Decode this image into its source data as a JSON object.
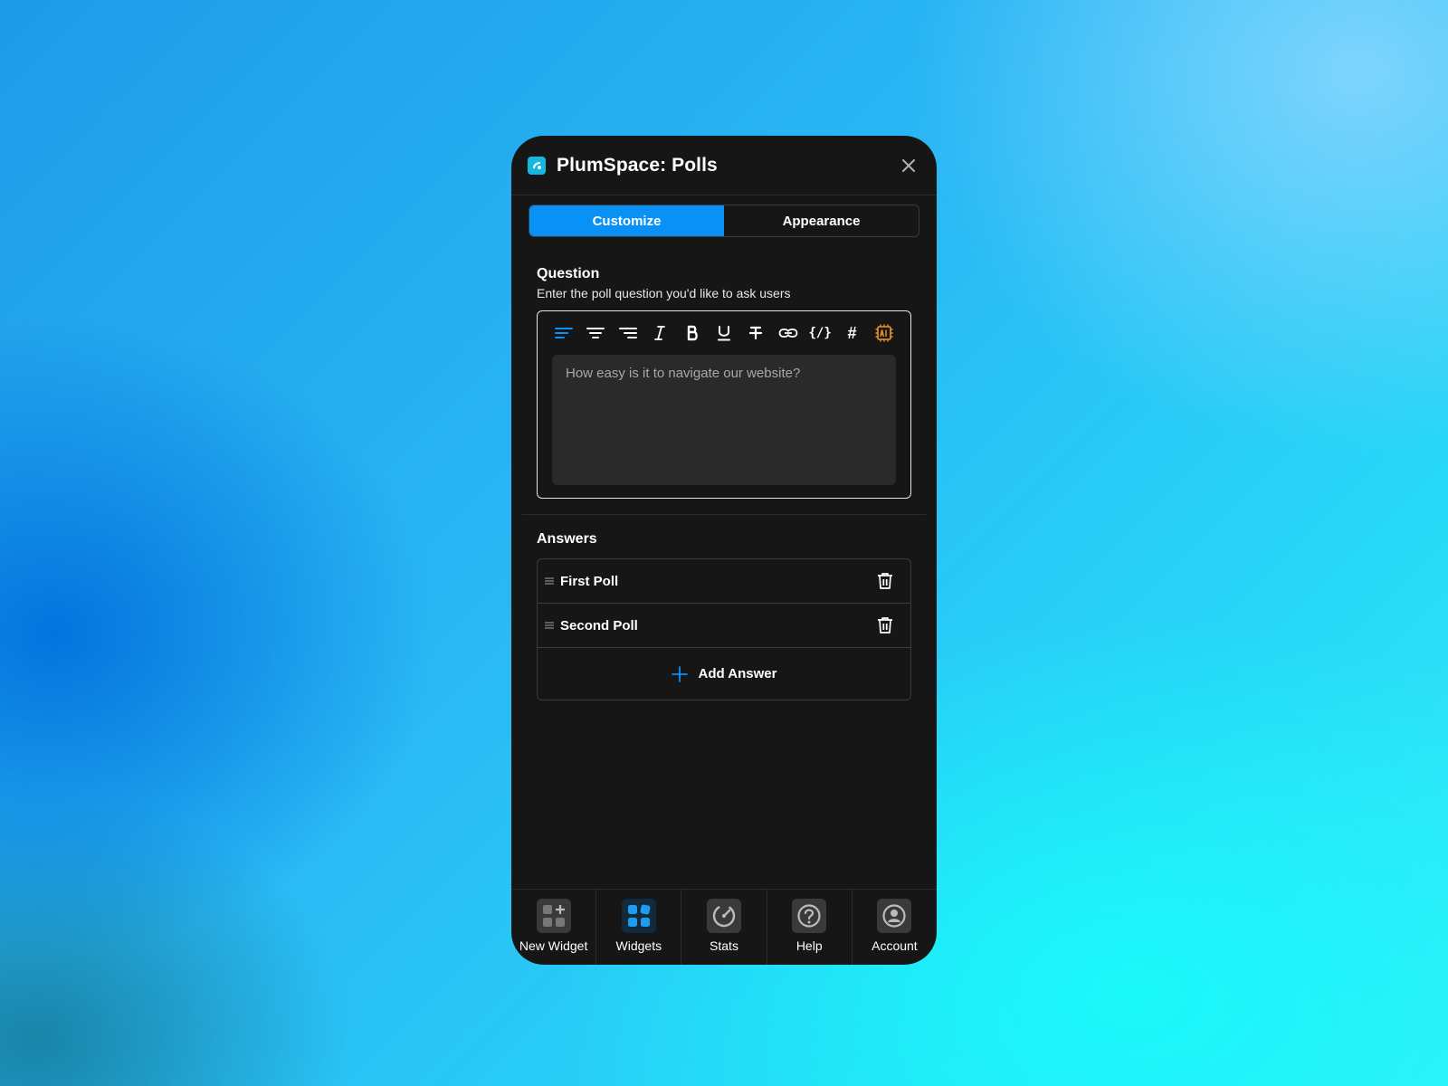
{
  "app": {
    "title": "PlumSpace: Polls"
  },
  "tabs": [
    {
      "label": "Customize",
      "active": true
    },
    {
      "label": "Appearance",
      "active": false
    }
  ],
  "question": {
    "title": "Question",
    "subtitle": "Enter the poll question you'd like to ask users",
    "placeholder": "How easy is it to navigate our website?",
    "toolbar": [
      "align-left-icon",
      "align-center-icon",
      "align-right-icon",
      "italic-icon",
      "bold-icon",
      "underline-icon",
      "strikethrough-icon",
      "link-icon",
      "code-icon",
      "hash-icon",
      "ai-chip-icon"
    ]
  },
  "answers": {
    "title": "Answers",
    "items": [
      {
        "label": "First Poll"
      },
      {
        "label": "Second Poll"
      }
    ],
    "add_label": "Add Answer"
  },
  "nav": [
    {
      "label": "New Widget",
      "icon": "new-widget-icon",
      "active": false
    },
    {
      "label": "Widgets",
      "icon": "widgets-icon",
      "active": true
    },
    {
      "label": "Stats",
      "icon": "stats-icon",
      "active": false
    },
    {
      "label": "Help",
      "icon": "help-icon",
      "active": false
    },
    {
      "label": "Account",
      "icon": "account-icon",
      "active": false
    }
  ],
  "colors": {
    "accent": "#0a91f5",
    "panel_bg": "#161616",
    "ai_orange": "#f0961e"
  }
}
